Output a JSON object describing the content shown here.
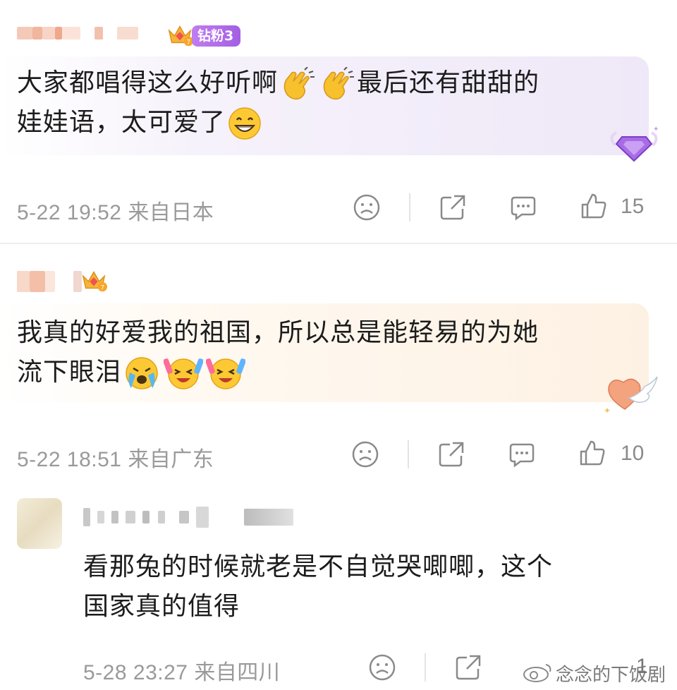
{
  "comments": [
    {
      "badge_label": "钻粉3",
      "text_line1": "大家都唱得这么好听啊",
      "text_line1b": "最后还有甜甜的",
      "text_line2": "娃娃语，太可爱了",
      "date": "5-22",
      "time": "19:52",
      "location": "来自日本",
      "like_count": "15"
    },
    {
      "text_line1": "我真的好爱我的祖国，所以总是能轻易的为她",
      "text_line2": "流下眼泪",
      "date": "5-22",
      "time": "18:51",
      "location": "来自广东",
      "like_count": "10"
    },
    {
      "text_line1": "看那兔的时候就老是不自觉哭唧唧，这个",
      "text_line2": "国家真的值得",
      "date": "5-28",
      "time": "23:27",
      "location": "来自四川",
      "like_count": "1"
    }
  ],
  "watermark": "念念的下饭剧",
  "icons": {
    "dislike": "frown-face-icon",
    "share": "share-icon",
    "reply": "comment-bubble-icon",
    "like": "thumbs-up-icon",
    "crown": "crown-icon"
  },
  "colors": {
    "badge": "#b26ee9",
    "meta_text": "#9a9a9a",
    "bubble1": "#f3effa",
    "bubble2": "#fdf5ea"
  }
}
